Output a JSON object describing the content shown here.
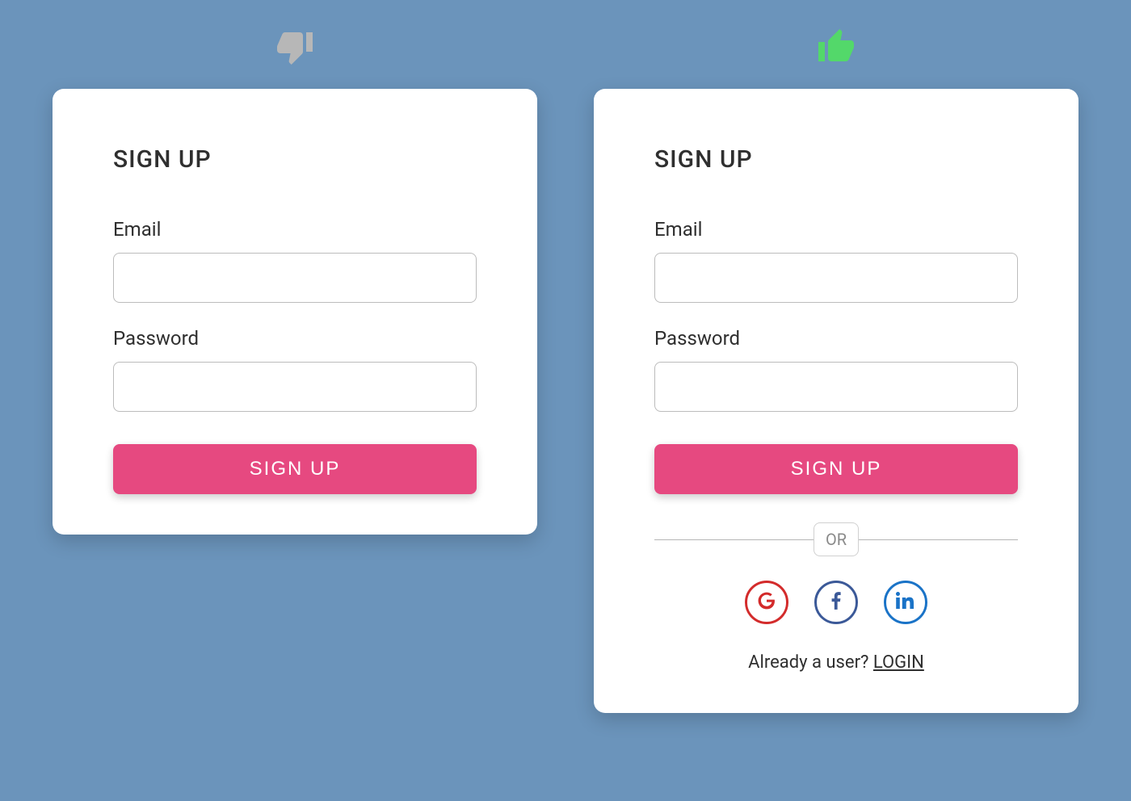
{
  "bad_example": {
    "title": "SIGN UP",
    "email_label": "Email",
    "password_label": "Password",
    "button_label": "SIGN UP"
  },
  "good_example": {
    "title": "SIGN UP",
    "email_label": "Email",
    "password_label": "Password",
    "button_label": "SIGN UP",
    "divider_label": "OR",
    "footer_prefix": "Already a user? ",
    "footer_link": "LOGIN"
  },
  "indicators": {
    "bad_color": "#b7b7b7",
    "good_color": "#53d86a"
  },
  "social": {
    "google": "G",
    "facebook": "f",
    "linkedin": "in"
  },
  "colors": {
    "background": "#6b94bb",
    "accent": "#e64980",
    "google": "#d32b2b",
    "facebook": "#3b5998",
    "linkedin": "#1a73c7"
  }
}
